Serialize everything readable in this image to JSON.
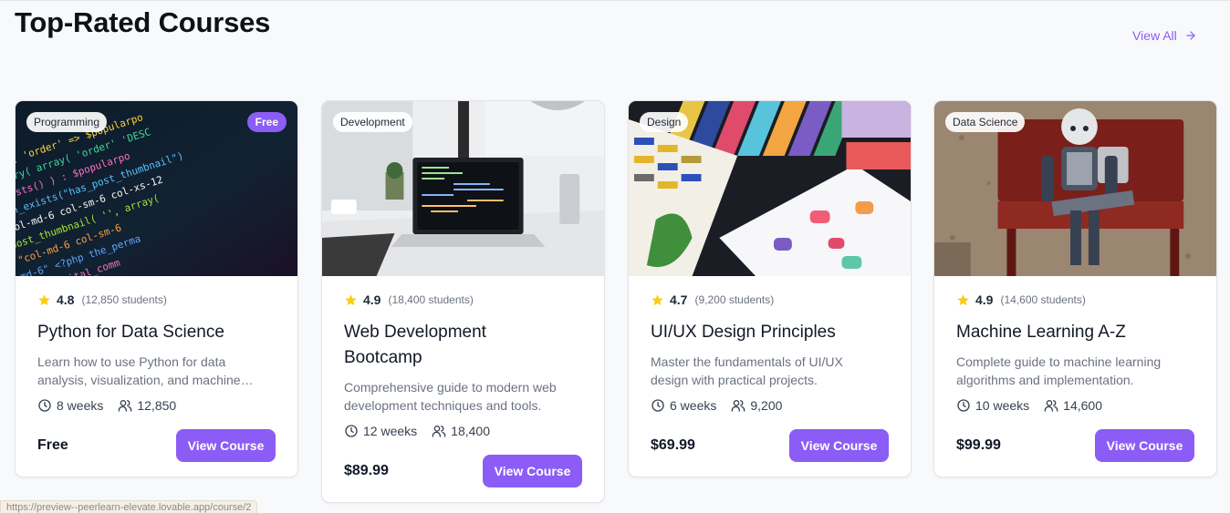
{
  "section": {
    "title": "Top-Rated Courses",
    "view_all": "View All"
  },
  "colors": {
    "accent": "#8b5cf6",
    "star": "#facc15"
  },
  "courses": [
    {
      "category": "Programming",
      "badge": "Free",
      "rating": "4.8",
      "students_text": "(12,850 students)",
      "title": "Python for Data Science",
      "description": "Learn how to use Python for data analysis, visualization, and machine learning.",
      "duration": "8 weeks",
      "enrolled": "12,850",
      "price": "Free",
      "button": "View Course",
      "image": "code-screen"
    },
    {
      "category": "Development",
      "rating": "4.9",
      "students_text": "(18,400 students)",
      "title": "Web Development Bootcamp",
      "description": "Comprehensive guide to modern web development techniques and tools.",
      "duration": "12 weeks",
      "enrolled": "18,400",
      "price": "$89.99",
      "button": "View Course",
      "image": "laptop-desk"
    },
    {
      "category": "Design",
      "rating": "4.7",
      "students_text": "(9,200 students)",
      "title": "UI/UX Design Principles",
      "description": "Master the fundamentals of UI/UX design with practical projects.",
      "duration": "6 weeks",
      "enrolled": "9,200",
      "price": "$69.99",
      "button": "View Course",
      "image": "color-swatches"
    },
    {
      "category": "Data Science",
      "rating": "4.9",
      "students_text": "(14,600 students)",
      "title": "Machine Learning A-Z",
      "description": "Complete guide to machine learning algorithms and implementation.",
      "duration": "10 weeks",
      "enrolled": "14,600",
      "price": "$99.99",
      "button": "View Course",
      "image": "robot-bench"
    }
  ],
  "status_bar": {
    "url": "https://preview--peerlearn-elevate.lovable.app/course/2"
  }
}
